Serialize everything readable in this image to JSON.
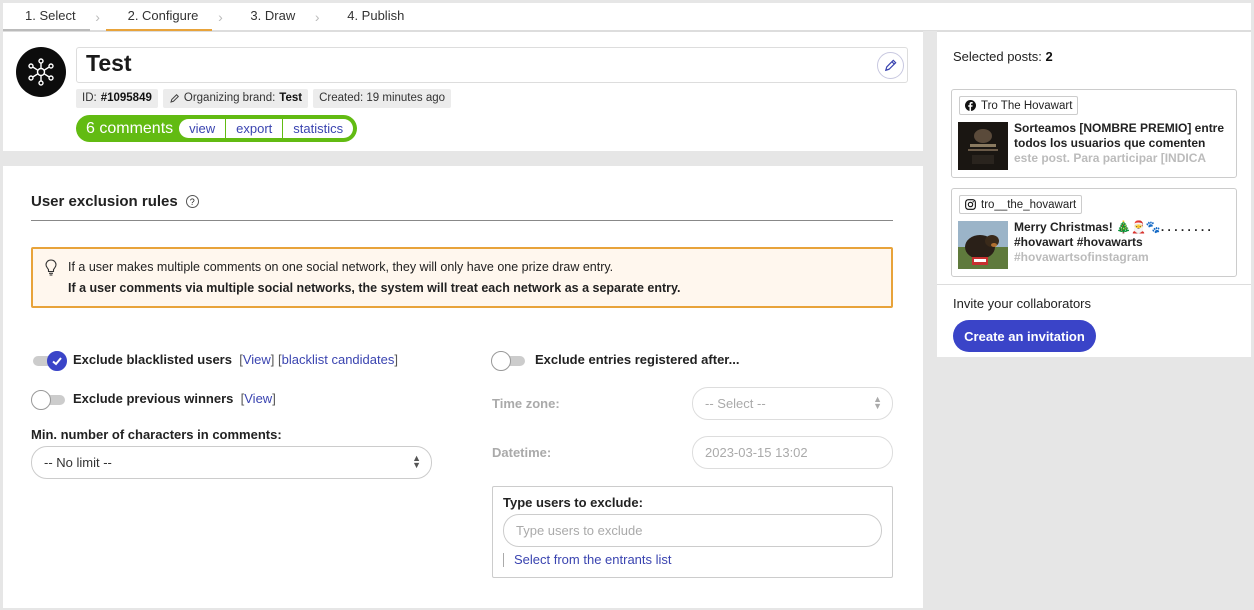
{
  "steps": [
    {
      "label": "1. Select"
    },
    {
      "label": "2. Configure"
    },
    {
      "label": "3. Draw"
    },
    {
      "label": "4. Publish"
    }
  ],
  "draw": {
    "title": "Test",
    "id_label": "ID:",
    "id_value": "#1095849",
    "brand_label": "Organizing brand:",
    "brand_value": "Test",
    "created": "Created: 19 minutes ago",
    "comments_count": "6 comments",
    "links": {
      "view": "view",
      "export": "export",
      "statistics": "statistics"
    }
  },
  "exclusion": {
    "section_title": "User exclusion rules",
    "help_icon": "question-icon",
    "notice_line1": "If a user makes multiple comments on one social network, they will only have one prize draw entry.",
    "notice_line2": "If a user comments via multiple social networks, the system will treat each network as a separate entry.",
    "blacklisted": {
      "label": "Exclude blacklisted users",
      "enabled": true,
      "view_link": "View",
      "candidates_link": "blacklist candidates"
    },
    "previous_winners": {
      "label": "Exclude previous winners",
      "enabled": false,
      "view_link": "View"
    },
    "min_chars": {
      "label": "Min. number of characters in comments:",
      "value": "-- No limit --"
    },
    "registered_after": {
      "label": "Exclude entries registered after...",
      "enabled": false
    },
    "time_zone": {
      "label": "Time zone:",
      "value": "-- Select --"
    },
    "datetime": {
      "label": "Datetime:",
      "placeholder": "2023-03-15 13:02"
    },
    "type_users": {
      "title": "Type users to exclude:",
      "placeholder": "Type users to exclude",
      "link": "Select from the entrants list"
    }
  },
  "sidebar": {
    "selected_label": "Selected posts:",
    "selected_count": "2",
    "posts": [
      {
        "network_icon": "facebook-icon",
        "account": "Tro The Hovawart",
        "text": "Sorteamos [NOMBRE PREMIO] entre todos los usuarios que comenten",
        "text_fade": "este post. Para participar [INDICA"
      },
      {
        "network_icon": "instagram-icon",
        "account": "tro__the_hovawart",
        "text": "Merry Christmas! 🎄🎅🐾. . . . . . . . #hovawart #hovawarts",
        "text_fade": "#hovawartsofinstagram"
      }
    ],
    "invite_label": "Invite your collaborators",
    "invite_button": "Create an invitation"
  },
  "colors": {
    "accent": "#3a44c8",
    "success": "#62bb12",
    "warning": "#e8a33a"
  }
}
